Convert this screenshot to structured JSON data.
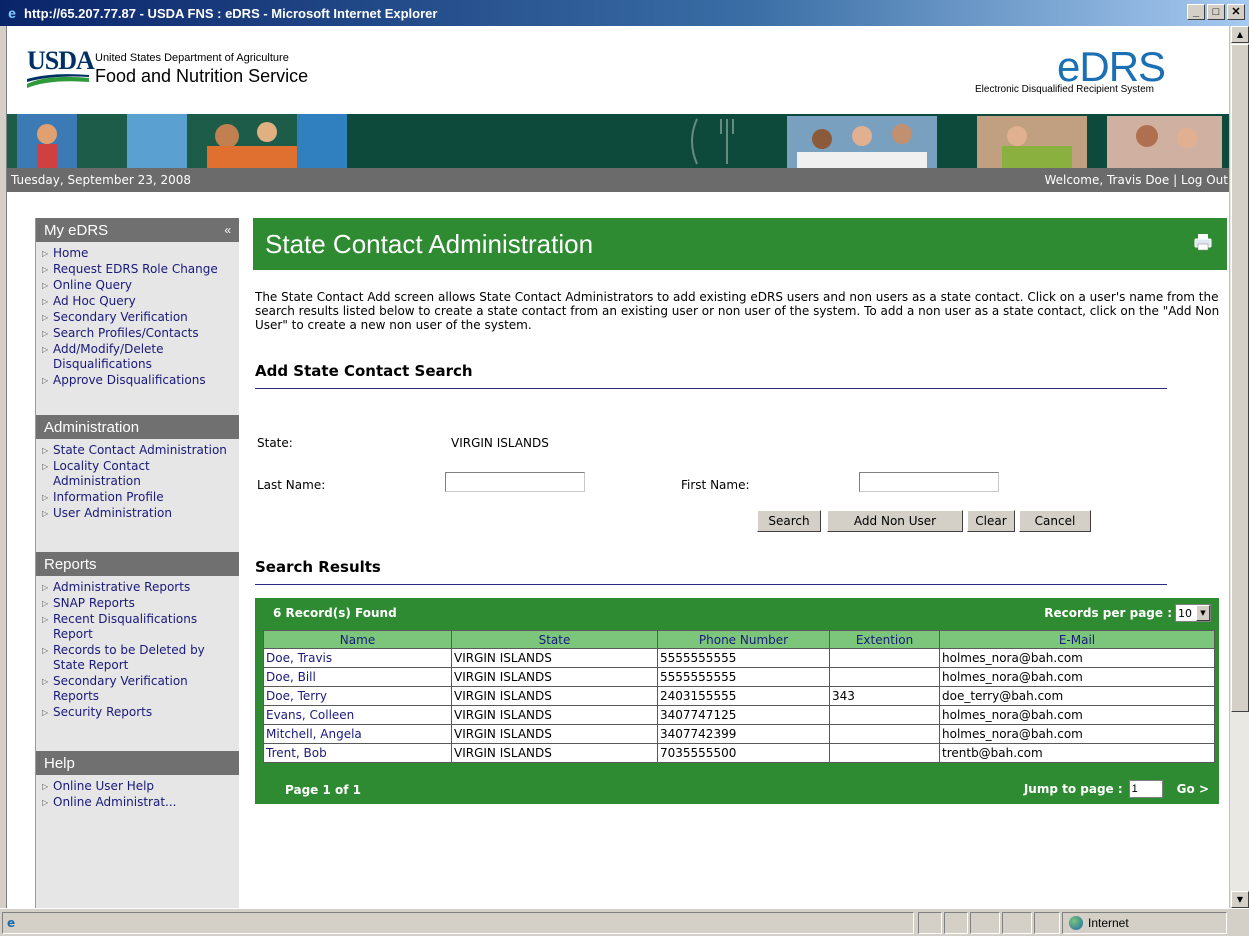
{
  "window": {
    "title": "http://65.207.77.87 - USDA FNS : eDRS - Microsoft Internet Explorer",
    "min": "_",
    "max": "□",
    "close": "✕"
  },
  "header": {
    "usda": "USDA",
    "dept": "United States Department of Agriculture",
    "agency": "Food and Nutrition Service",
    "logo": "eDRS",
    "logo_sub": "Electronic Disqualified Recipient System"
  },
  "datebar": {
    "date": "Tuesday, September 23, 2008",
    "welcome": "Welcome, Travis Doe",
    "sep": "|",
    "logout": "Log Out"
  },
  "sidebar": {
    "collapse": "«",
    "sections": [
      {
        "title": "My eDRS",
        "items": [
          "Home",
          "Request EDRS Role Change",
          "Online Query",
          "Ad Hoc Query",
          "Secondary Verification",
          "Search Profiles/Contacts",
          "Add/Modify/Delete Disqualifications",
          "Approve Disqualifications"
        ]
      },
      {
        "title": "Administration",
        "items": [
          "State Contact Administration",
          "Locality Contact Administration",
          "Information Profile",
          "User Administration"
        ]
      },
      {
        "title": "Reports",
        "items": [
          "Administrative Reports",
          "SNAP Reports",
          "Recent Disqualifications Report",
          "Records to be Deleted by State Report",
          "Secondary Verification Reports",
          "Security Reports"
        ]
      },
      {
        "title": "Help",
        "items": [
          "Online User Help",
          "Online Administrat..."
        ]
      }
    ]
  },
  "main": {
    "title": "State Contact Administration",
    "intro": "The State Contact Add screen allows State Contact Administrators to add existing eDRS users and non users as a state contact. Click on a user's name from the search results listed below to create a state contact from an existing user or non user of the system. To add a non user as a state contact, click on the \"Add Non User\" to create a new non user of the system.",
    "search_title": "Add State Contact Search",
    "state_label": "State:",
    "state_value": "VIRGIN ISLANDS",
    "last_label": "Last Name:",
    "first_label": "First Name:",
    "last_value": "",
    "first_value": "",
    "buttons": {
      "search": "Search",
      "add": "Add Non User",
      "clear": "Clear",
      "cancel": "Cancel"
    },
    "results_title": "Search Results",
    "results": {
      "count": "6 Record(s) Found",
      "rpp_label": "Records per page :",
      "rpp_value": "10",
      "columns": [
        "Name",
        "State",
        "Phone Number",
        "Extention",
        "E-Mail"
      ],
      "rows": [
        [
          "Doe, Travis",
          "VIRGIN ISLANDS",
          "5555555555",
          "",
          "holmes_nora@bah.com"
        ],
        [
          "Doe, Bill",
          "VIRGIN ISLANDS",
          "5555555555",
          "",
          "holmes_nora@bah.com"
        ],
        [
          "Doe, Terry",
          "VIRGIN ISLANDS",
          "2403155555",
          "343",
          "doe_terry@bah.com"
        ],
        [
          "Evans, Colleen",
          "VIRGIN ISLANDS",
          "3407747125",
          "",
          "holmes_nora@bah.com"
        ],
        [
          "Mitchell, Angela",
          "VIRGIN ISLANDS",
          "3407742399",
          "",
          "holmes_nora@bah.com"
        ],
        [
          "Trent, Bob",
          "VIRGIN ISLANDS",
          "7035555500",
          "",
          "trentb@bah.com"
        ]
      ],
      "page_info": "Page 1 of 1",
      "jump_label": "Jump to page :",
      "jump_value": "1",
      "go": "Go >"
    }
  },
  "status": {
    "zone": "Internet"
  },
  "colors": {
    "green": "#2e8b32",
    "header_green": "#7bc67b",
    "sidebar_head": "#707070",
    "link": "#1a1a7a"
  }
}
